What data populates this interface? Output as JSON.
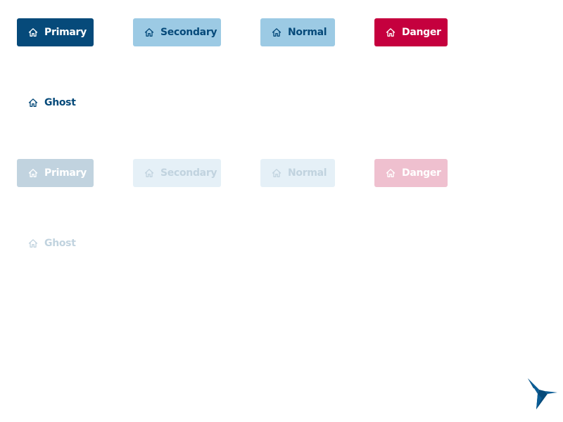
{
  "buttons": {
    "enabled": {
      "primary": "Primary",
      "secondary": "Secondary",
      "normal": "Normal",
      "danger": "Danger",
      "ghost": "Ghost"
    },
    "disabled": {
      "primary": "Primary",
      "secondary": "Secondary",
      "normal": "Normal",
      "danger": "Danger",
      "ghost": "Ghost"
    }
  },
  "icons": {
    "button_icon": "home-icon",
    "logo": "hummingbird-logo"
  },
  "colors": {
    "primary": "#064a7a",
    "secondary": "#9ccae4",
    "danger": "#c5003e",
    "disabled_primary": "#c1d3df",
    "disabled_secondary": "#e5f0f7",
    "disabled_danger": "#efc0cf"
  }
}
